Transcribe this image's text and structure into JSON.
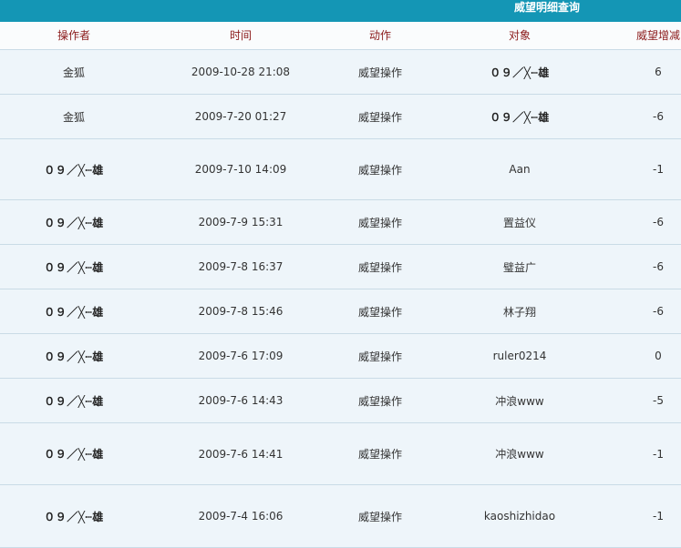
{
  "page_title": "威望明细查询",
  "columns": {
    "operator": "操作者",
    "time": "时间",
    "action": "动作",
    "target": "对象",
    "delta": "威望增减"
  },
  "rows": [
    {
      "operator": "金狐",
      "time": "2009-10-28 21:08",
      "action": "威望操作",
      "target": "０９／╳┉雄",
      "delta": "6"
    },
    {
      "operator": "金狐",
      "time": "2009-7-20 01:27",
      "action": "威望操作",
      "target": "０９／╳┉雄",
      "delta": "-6"
    },
    {
      "operator": "０９／╳┉雄",
      "time": "2009-7-10 14:09",
      "action": "威望操作",
      "target": "Aan",
      "delta": "-1"
    },
    {
      "operator": "０９／╳┉雄",
      "time": "2009-7-9 15:31",
      "action": "威望操作",
      "target": "置益仪",
      "delta": "-6"
    },
    {
      "operator": "０９／╳┉雄",
      "time": "2009-7-8 16:37",
      "action": "威望操作",
      "target": "璧益广",
      "delta": "-6"
    },
    {
      "operator": "０９／╳┉雄",
      "time": "2009-7-8 15:46",
      "action": "威望操作",
      "target": "林子翔",
      "delta": "-6"
    },
    {
      "operator": "０９／╳┉雄",
      "time": "2009-7-6 17:09",
      "action": "威望操作",
      "target": "ruler0214",
      "delta": "0"
    },
    {
      "operator": "０９／╳┉雄",
      "time": "2009-7-6 14:43",
      "action": "威望操作",
      "target": "冲浪www",
      "delta": "-5"
    },
    {
      "operator": "０９／╳┉雄",
      "time": "2009-7-6 14:41",
      "action": "威望操作",
      "target": "冲浪www",
      "delta": "-1"
    },
    {
      "operator": "０９／╳┉雄",
      "time": "2009-7-4 16:06",
      "action": "威望操作",
      "target": "kaoshizhidao",
      "delta": "-1"
    }
  ]
}
